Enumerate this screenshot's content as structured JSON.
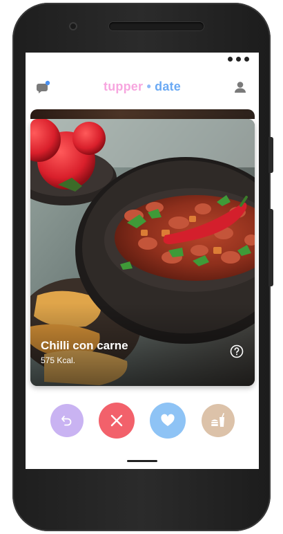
{
  "app": {
    "logo_part1": "tupper",
    "logo_separator": "•",
    "logo_part2": "date"
  },
  "card": {
    "dish_name": "Chilli con carne",
    "calories": "575 Kcal."
  },
  "colors": {
    "logo_pink": "#f7a6df",
    "logo_blue": "#6aa9f4",
    "undo": "#c9b3f2",
    "dislike": "#f2616b",
    "like": "#8ec3f5",
    "order": "#dcc2a9"
  },
  "icons": {
    "chat": "chat-icon",
    "profile": "profile-icon",
    "help": "help-icon",
    "undo": "undo-icon",
    "dislike": "close-icon",
    "like": "heart-icon",
    "order": "order-food-icon",
    "menu": "more-dots-icon"
  }
}
